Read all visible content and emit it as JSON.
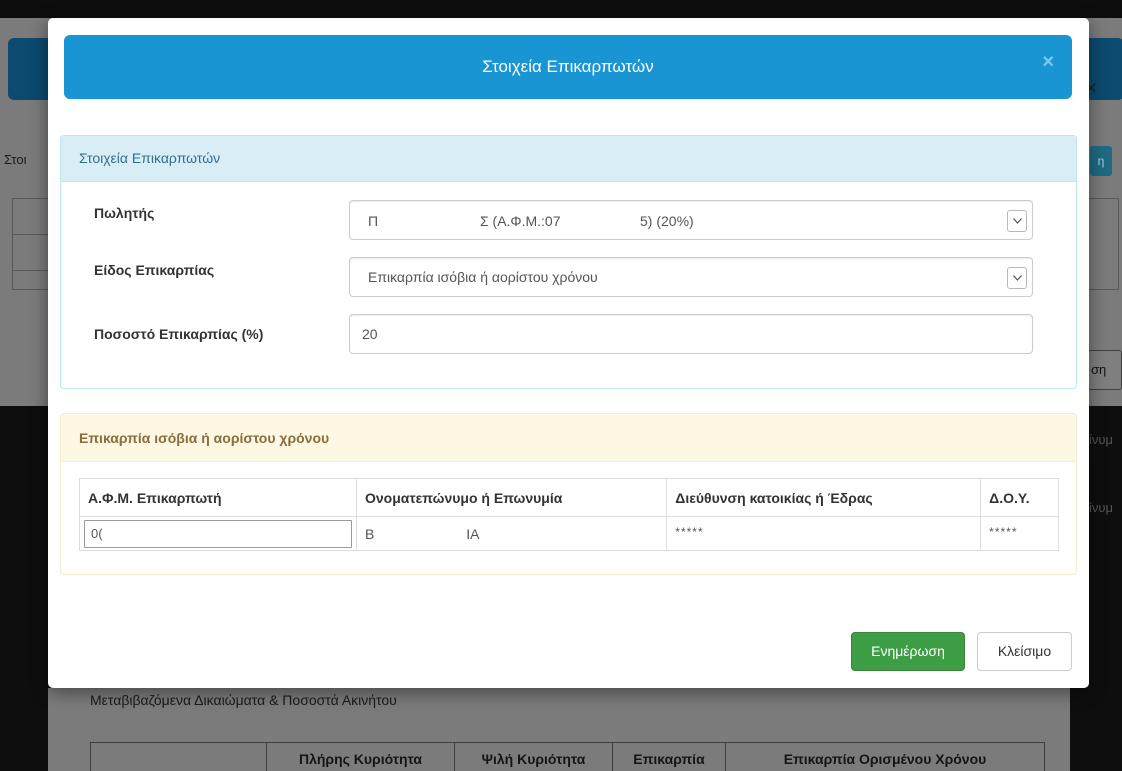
{
  "background": {
    "left_label": "Στοι",
    "right_button": "η",
    "right_button2": "ση",
    "right_text_1": "ίνυμ",
    "right_text_2": "ίνυμ",
    "bottom_title": "Μεταβιβαζόμενα Δικαιώματα & Ποσοστά Ακινήτου",
    "bottom_columns": [
      "",
      "Πλήρης Κυριότητα",
      "Ψιλή Κυριότητα",
      "Επικαρπία",
      "Επικαρπία Ορισμένου Χρόνου"
    ]
  },
  "modal": {
    "title": "Στοιχεία Επικαρπωτών",
    "close_label": "×",
    "details_panel": {
      "heading": "Στοιχεία Επικαρπωτών",
      "seller_label": "Πωλητής",
      "seller_value_parts": [
        "Π",
        "Σ (Α.Φ.Μ.:07",
        "5) (20%)"
      ],
      "usufruct_type_label": "Είδος Επικαρπίας",
      "usufruct_type_value": "Επικαρπία ισόβια ή αορίστου χρόνου",
      "percentage_label": "Ποσοστό Επικαρπίας (%)",
      "percentage_value": "20"
    },
    "beneficiaries_panel": {
      "heading": "Επικαρπία ισόβια ή αορίστου χρόνου",
      "columns": [
        "Α.Φ.Μ. Επικαρπωτή",
        "Ονοματεπώνυμο ή Επωνυμία",
        "Διεύθυνση κατοικίας ή Έδρας",
        "Δ.Ο.Υ."
      ],
      "rows": [
        {
          "afm": "0(",
          "name_parts": [
            "Β",
            "ΙΑ"
          ],
          "address": "*****",
          "doy": "*****"
        }
      ]
    },
    "footer": {
      "update_button": "Ενημέρωση",
      "close_button": "Κλείσιμο"
    }
  },
  "colors": {
    "header_blue": "#1a95d3",
    "success_green": "#3d9e45",
    "info_bg": "#d9edf7",
    "warning_bg": "#fcf8e3"
  }
}
